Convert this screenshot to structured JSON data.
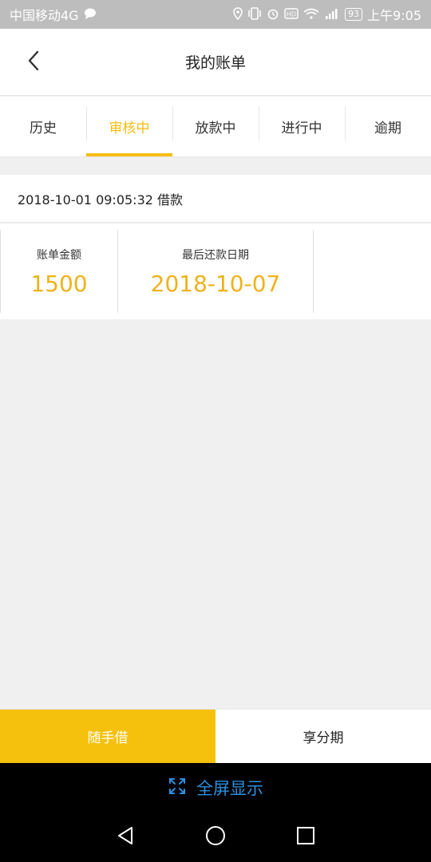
{
  "status_bar": {
    "carrier": "中国移动4G",
    "battery": "93",
    "time": "上午9:05"
  },
  "header": {
    "title": "我的账单",
    "back_icon": "chevron-left-icon"
  },
  "tabs": [
    {
      "label": "历史",
      "active": false
    },
    {
      "label": "审核中",
      "active": true
    },
    {
      "label": "放款中",
      "active": false
    },
    {
      "label": "进行中",
      "active": false
    },
    {
      "label": "逾期",
      "active": false
    }
  ],
  "bill": {
    "header": "2018-10-01 09:05:32 借款",
    "amount_label": "账单金额",
    "amount_value": "1500",
    "due_label": "最后还款日期",
    "due_value": "2018-10-07"
  },
  "actions": {
    "primary": "随手借",
    "secondary": "享分期"
  },
  "fullscreen": {
    "label": "全屏显示"
  },
  "colors": {
    "accent": "#f5bd10",
    "value": "#f0b21a",
    "fullscreen": "#2b8fe0"
  }
}
